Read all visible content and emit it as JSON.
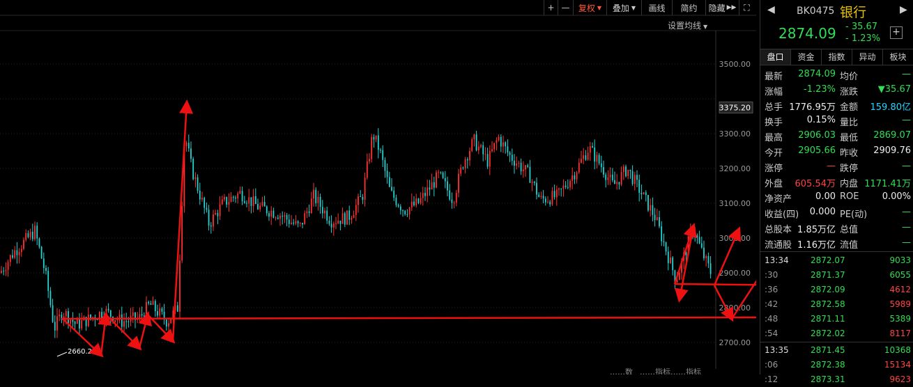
{
  "toolbar": {
    "plus": "+",
    "minus": "—",
    "adjust": "复权",
    "overlay": "叠加",
    "draw": "画线",
    "simple": "简约",
    "hide": "隐藏",
    "fullscreen": "⛶"
  },
  "ma_setting": "设置均线",
  "chart_data": {
    "type": "candlestick",
    "yaxis_ticks": [
      "3500.00",
      "3375.20",
      "3300.00",
      "3200.00",
      "3100.00",
      "3000.00",
      "2900.00",
      "2800.00",
      "2700.00"
    ],
    "ylim": [
      2640,
      3580
    ],
    "current_price_label": "3375.20",
    "low_label": "2660.2",
    "bottom_labels": [
      "……数",
      "……指标",
      "……指标"
    ]
  },
  "quote": {
    "code": "BK0475",
    "name": "银行",
    "price": "2874.09",
    "change": "- 35.67",
    "change_pct": "- 1.23%",
    "add_icon": "+"
  },
  "tabs": [
    "盘口",
    "资金",
    "指数",
    "异动",
    "板块"
  ],
  "stats": [
    {
      "l1": "最新",
      "v1": "2874.09",
      "c1": "g",
      "l2": "均价",
      "v2": "—",
      "c2": "g"
    },
    {
      "l1": "涨幅",
      "v1": "-1.23%",
      "c1": "g",
      "l2": "涨跌",
      "v2": "▼35.67",
      "c2": "g"
    },
    {
      "l1": "总手",
      "v1": "1776.95万",
      "c1": "w",
      "l2": "金额",
      "v2": "159.80亿",
      "c2": "c"
    },
    {
      "l1": "换手",
      "v1": "0.15%",
      "c1": "w",
      "l2": "量比",
      "v2": "—",
      "c2": "g"
    },
    {
      "l1": "最高",
      "v1": "2906.03",
      "c1": "g",
      "l2": "最低",
      "v2": "2869.07",
      "c2": "g"
    },
    {
      "l1": "今开",
      "v1": "2905.66",
      "c1": "g",
      "l2": "昨收",
      "v2": "2909.76",
      "c2": "w"
    },
    {
      "l1": "涨停",
      "v1": "—",
      "c1": "r",
      "l2": "跌停",
      "v2": "—",
      "c2": "g"
    },
    {
      "l1": "外盘",
      "v1": "605.54万",
      "c1": "r",
      "l2": "内盘",
      "v2": "1171.41万",
      "c2": "g"
    },
    {
      "l1": "净资产",
      "v1": "0.00",
      "c1": "w",
      "l2": "ROE",
      "v2": "0.00%",
      "c2": "w"
    },
    {
      "l1": "收益(四)",
      "v1": "0.000",
      "c1": "w",
      "l2": "PE(动)",
      "v2": "—",
      "c2": "g"
    },
    {
      "l1": "总股本",
      "v1": "1.85万亿",
      "c1": "w",
      "l2": "总值",
      "v2": "—",
      "c2": "g"
    },
    {
      "l1": "流通股",
      "v1": "1.16万亿",
      "c1": "w",
      "l2": "流值",
      "v2": "—",
      "c2": "g"
    }
  ],
  "ticks": [
    {
      "t": "13:34",
      "p": "2872.07",
      "v": "9033",
      "vc": "g"
    },
    {
      "t": ":30",
      "p": "2871.37",
      "v": "6055",
      "vc": "g"
    },
    {
      "t": ":36",
      "p": "2872.09",
      "v": "4612",
      "vc": "r"
    },
    {
      "t": ":42",
      "p": "2872.58",
      "v": "5989",
      "vc": "r"
    },
    {
      "t": ":48",
      "p": "2871.11",
      "v": "5389",
      "vc": "g"
    },
    {
      "t": ":54",
      "p": "2872.02",
      "v": "8117",
      "vc": "r"
    },
    {
      "t": "13:35",
      "p": "2871.45",
      "v": "10368",
      "vc": "g"
    },
    {
      "t": ":06",
      "p": "2872.38",
      "v": "15134",
      "vc": "r"
    },
    {
      "t": ":12",
      "p": "2873.31",
      "v": "9623",
      "vc": "r"
    }
  ],
  "colors": {
    "up": "#ff3333",
    "down": "#22d4d4",
    "annot": "#ee1111",
    "green": "#33dd55",
    "gold": "#e8c000"
  }
}
